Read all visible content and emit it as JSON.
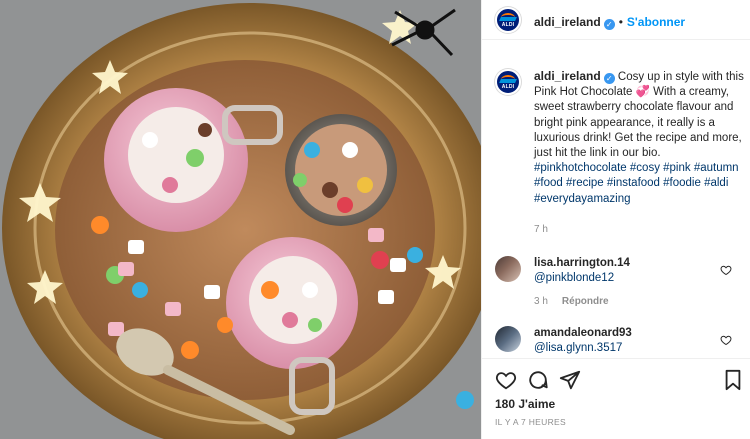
{
  "post": {
    "image_alt": "Pink hot chocolate in glass mugs on a gold tray",
    "account": {
      "username": "aldi_ireland",
      "avatar_text": "ALDI",
      "follow_separator": "•",
      "follow_label": "S'abonner"
    },
    "caption": {
      "text": "Cosy up in style with this Pink Hot Chocolate 💞 With a creamy, sweet strawberry chocolate flavour and bright pink appearance, it really is a luxurious drink! Get the recipe and more, just hit the link in our bio.",
      "hashtags": "#pinkhotchocolate #cosy #pink #autumn #food #recipe #instafood #foodie #aldi #everydayamazing",
      "time_ago": "7 h"
    },
    "comments": [
      {
        "username": "lisa.harrington.14",
        "text": "@pinkblonde12",
        "time_ago": "3 h",
        "reply_label": "Répondre"
      },
      {
        "username": "amandaleonard93",
        "text": "@lisa.glynn.3517"
      }
    ],
    "likes_label": "180 J'aime",
    "posted_label": "IL Y A 7 HEURES"
  },
  "colors": {
    "link": "#00376b",
    "follow": "#0095f6",
    "verified": "#3897f0",
    "muted": "#8e8e8e",
    "aldi_blue": "#001e78",
    "aldi_orange": "#ff7800"
  },
  "icons": [
    "verified-badge-icon",
    "heart-icon",
    "comment-icon",
    "share-icon",
    "save-icon",
    "heart-outline-icon"
  ]
}
